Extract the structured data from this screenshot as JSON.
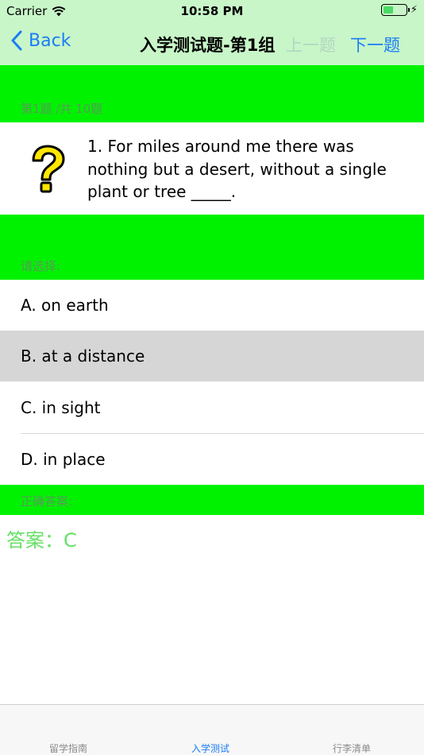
{
  "status_bar": {
    "carrier": "Carrier",
    "time": "10:58 PM",
    "battery_level": 0.45
  },
  "nav": {
    "back_label": "Back",
    "title": "入学测试题-第1组",
    "prev_label": "上一题",
    "next_label": "下一题"
  },
  "progress_label": "第1题 /共 10题",
  "question": {
    "text": "1. For miles around me there was nothing but a desert, without a single plant or tree _____."
  },
  "choose_label": "请选择:",
  "options": [
    {
      "label": "A. on earth",
      "selected": false
    },
    {
      "label": "B. at a distance",
      "selected": true
    },
    {
      "label": "C. in sight",
      "selected": false
    },
    {
      "label": "D. in place",
      "selected": false
    }
  ],
  "correct_label": "正确答案:",
  "answer_text": "答案：C",
  "tabs": [
    {
      "label": "留学指南",
      "active": false
    },
    {
      "label": "入学测试",
      "active": true
    },
    {
      "label": "行李清单",
      "active": false
    }
  ],
  "colors": {
    "nav_background": "#c8f6c8",
    "band_green": "#00f200",
    "accent_blue": "#1b7cf5",
    "selected_row": "#d6d6d6",
    "answer_green": "#66e066"
  }
}
